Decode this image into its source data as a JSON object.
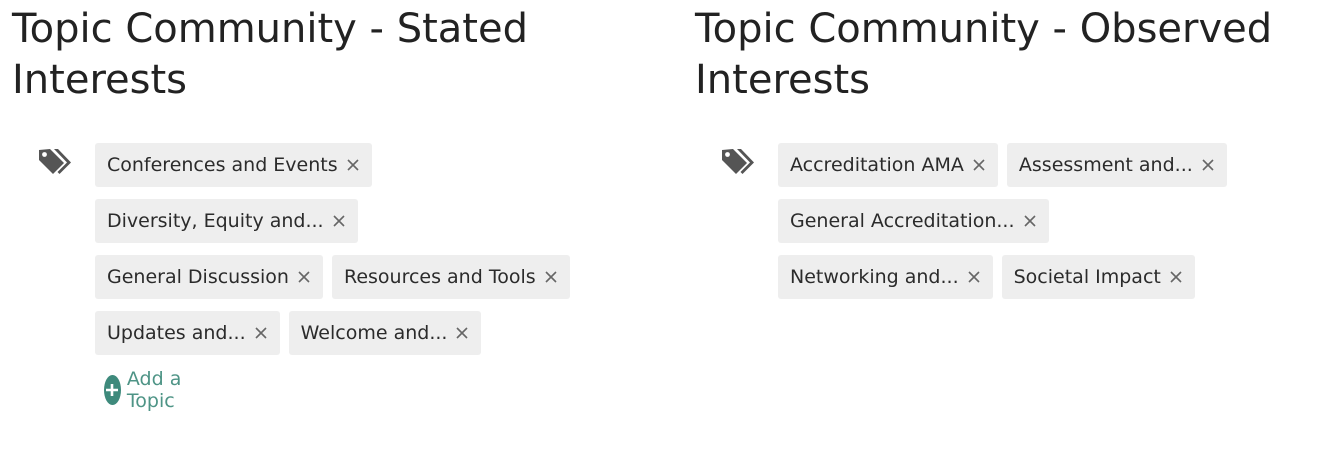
{
  "stated": {
    "title": "Topic Community - Stated Interests",
    "rows": [
      [
        {
          "label": "Conferences and Events"
        }
      ],
      [
        {
          "label": "Diversity, Equity and..."
        }
      ],
      [
        {
          "label": "General Discussion"
        },
        {
          "label": "Resources and Tools"
        }
      ],
      [
        {
          "label": "Updates and..."
        },
        {
          "label": "Welcome and..."
        }
      ]
    ],
    "add_label": "Add a Topic"
  },
  "observed": {
    "title": "Topic Community - Observed Interests",
    "rows": [
      [
        {
          "label": "Accreditation AMA"
        },
        {
          "label": "Assessment and..."
        }
      ],
      [
        {
          "label": "General Accreditation..."
        }
      ],
      [
        {
          "label": "Networking and..."
        },
        {
          "label": "Societal Impact"
        }
      ]
    ]
  },
  "icons": {
    "topics": "tags-icon",
    "remove": "close-icon",
    "add": "plus-circle-icon"
  },
  "colors": {
    "chip_background": "#eeeeee",
    "accent": "#3e8a7c",
    "accent_text": "#4e9486",
    "icon": "#555555"
  }
}
